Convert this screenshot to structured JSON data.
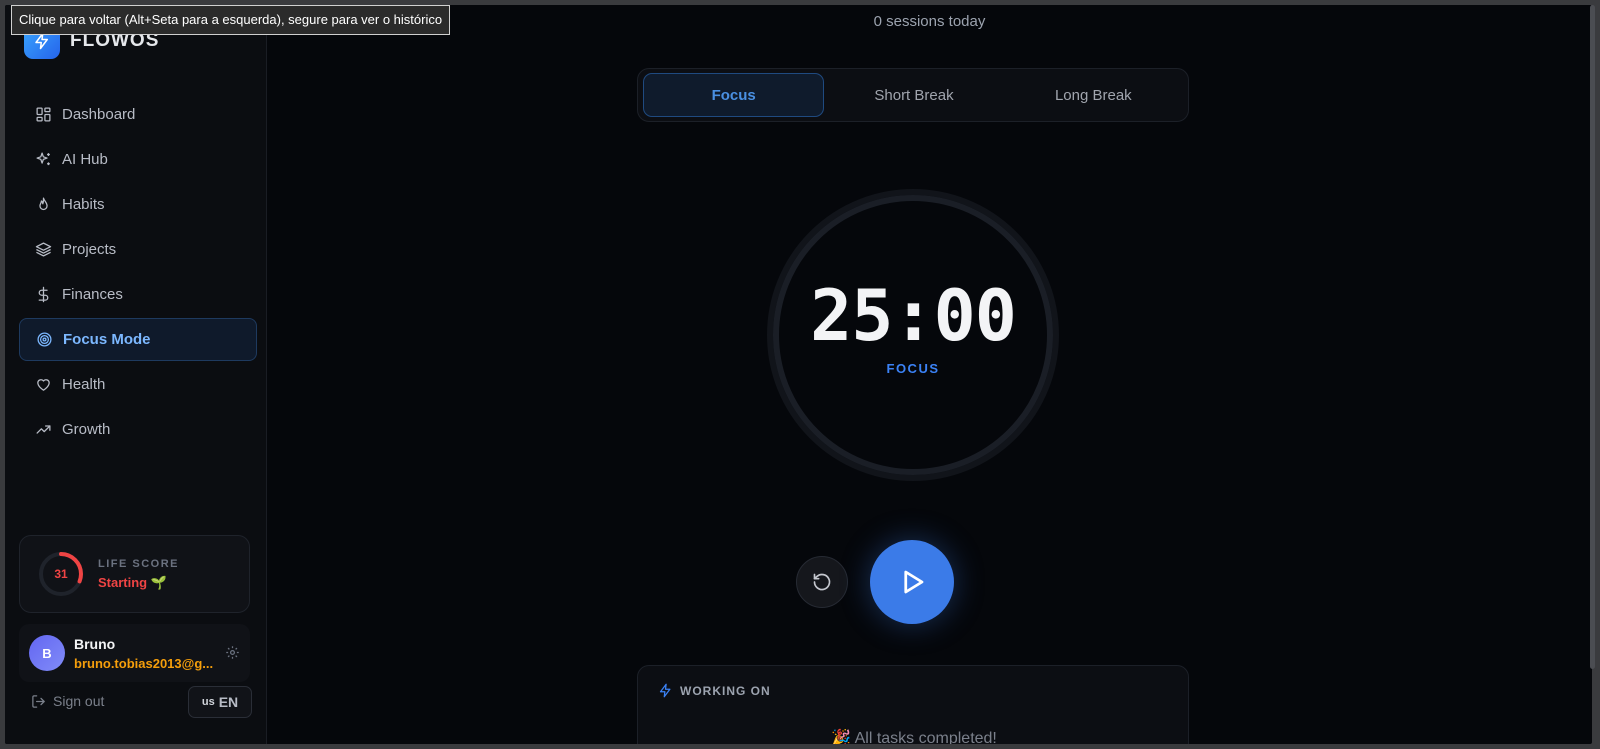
{
  "tooltip": "Clique para voltar (Alt+Seta para a esquerda), segure para ver o histórico",
  "app": {
    "name": "FLOWOS"
  },
  "sidebar": {
    "items": [
      {
        "label": "Dashboard",
        "icon": "grid-icon"
      },
      {
        "label": "AI Hub",
        "icon": "sparkles-icon"
      },
      {
        "label": "Habits",
        "icon": "flame-icon"
      },
      {
        "label": "Projects",
        "icon": "layers-icon"
      },
      {
        "label": "Finances",
        "icon": "dollar-icon"
      },
      {
        "label": "Focus Mode",
        "icon": "target-icon",
        "active": true
      },
      {
        "label": "Health",
        "icon": "heart-icon"
      },
      {
        "label": "Growth",
        "icon": "trending-up-icon"
      }
    ],
    "life_score": {
      "label": "LIFE SCORE",
      "value": "31",
      "status": "Starting 🌱",
      "progress": 0.31
    },
    "user": {
      "initial": "B",
      "name": "Bruno",
      "email": "bruno.tobias2013@g..."
    },
    "signout_label": "Sign out",
    "language": {
      "flag": "us",
      "code": "EN"
    }
  },
  "main": {
    "sessions_text": "0 sessions today",
    "tabs": [
      {
        "label": "Focus",
        "active": true
      },
      {
        "label": "Short Break"
      },
      {
        "label": "Long Break"
      }
    ],
    "timer": {
      "time": "25:00",
      "label": "FOCUS"
    },
    "working_on": {
      "label": "WORKING ON",
      "empty_text": "All tasks completed!",
      "empty_emoji": "🎉"
    }
  },
  "colors": {
    "accent": "#3b7be8",
    "danger": "#ef4444",
    "warning": "#f59e0b",
    "background": "#05070b"
  }
}
